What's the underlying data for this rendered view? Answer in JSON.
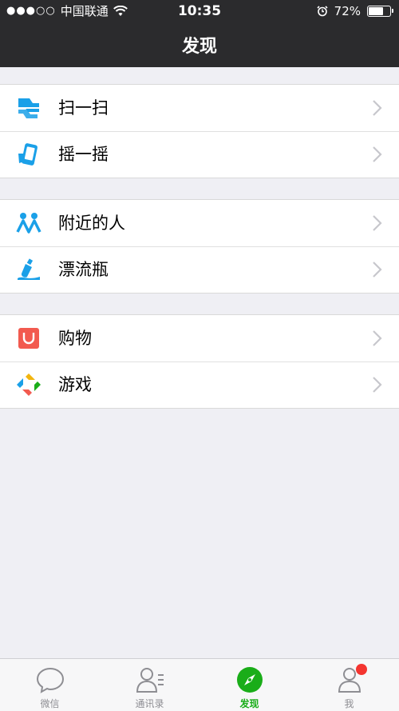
{
  "status_bar": {
    "signal": "●●●○○",
    "carrier": "中国联通",
    "time": "10:35",
    "battery_percent": "72%",
    "battery_level": 0.72
  },
  "nav": {
    "title": "发现"
  },
  "groups": [
    {
      "items": [
        {
          "label": "扫一扫",
          "icon": "scan-icon"
        },
        {
          "label": "摇一摇",
          "icon": "shake-icon"
        }
      ]
    },
    {
      "items": [
        {
          "label": "附近的人",
          "icon": "people-nearby-icon"
        },
        {
          "label": "漂流瓶",
          "icon": "drift-bottle-icon"
        }
      ]
    },
    {
      "items": [
        {
          "label": "购物",
          "icon": "shopping-icon"
        },
        {
          "label": "游戏",
          "icon": "games-icon"
        }
      ]
    }
  ],
  "tabbar": {
    "tabs": [
      {
        "label": "微信",
        "icon": "chat-bubble-icon",
        "active": false
      },
      {
        "label": "通讯录",
        "icon": "contacts-icon",
        "active": false
      },
      {
        "label": "发现",
        "icon": "compass-icon",
        "active": true
      },
      {
        "label": "我",
        "icon": "profile-icon",
        "active": false,
        "badge": true
      }
    ]
  },
  "colors": {
    "nav_bg": "#2b2b2d",
    "page_bg": "#efeff4",
    "active_tab": "#1aad19",
    "inactive_tab": "#8e8e93",
    "badge": "#f43530",
    "blue_icon": "#1aa0e8",
    "shopping_icon": "#f25a4f"
  }
}
